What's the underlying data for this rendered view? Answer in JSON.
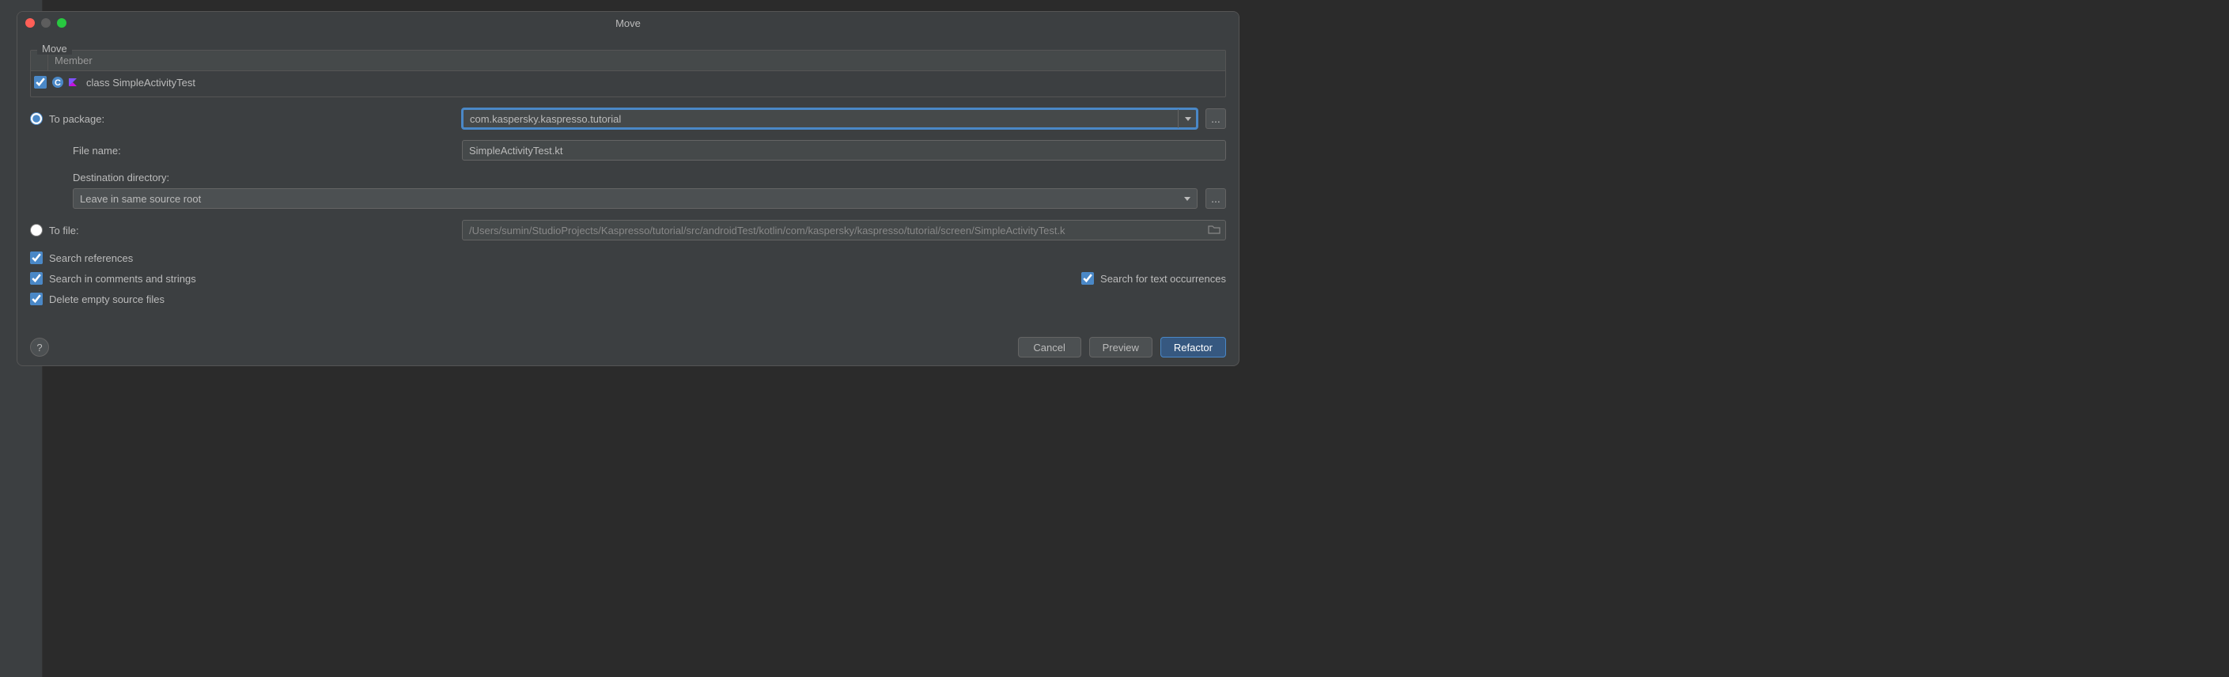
{
  "dialog": {
    "title": "Move"
  },
  "fieldset": {
    "legend": "Move",
    "member_header": "Member",
    "member": {
      "checked": true,
      "text": "class SimpleActivityTest"
    }
  },
  "destination": {
    "to_package": {
      "label": "To package:",
      "value": "com.kaspersky.kaspresso.tutorial",
      "selected": true
    },
    "file_name": {
      "label": "File name:",
      "value": "SimpleActivityTest.kt"
    },
    "dest_dir": {
      "label": "Destination directory:",
      "value": "Leave in same source root"
    },
    "to_file": {
      "label": "To file:",
      "value": "/Users/sumin/StudioProjects/Kaspresso/tutorial/src/androidTest/kotlin/com/kaspersky/kaspresso/tutorial/screen/SimpleActivityTest.k",
      "selected": false
    }
  },
  "options": {
    "search_references": "Search references",
    "search_comments": "Search in comments and strings",
    "search_text": "Search for text occurrences",
    "delete_empty": "Delete empty source files"
  },
  "buttons": {
    "cancel": "Cancel",
    "preview": "Preview",
    "refactor": "Refactor",
    "ellipsis": "...",
    "help": "?"
  }
}
